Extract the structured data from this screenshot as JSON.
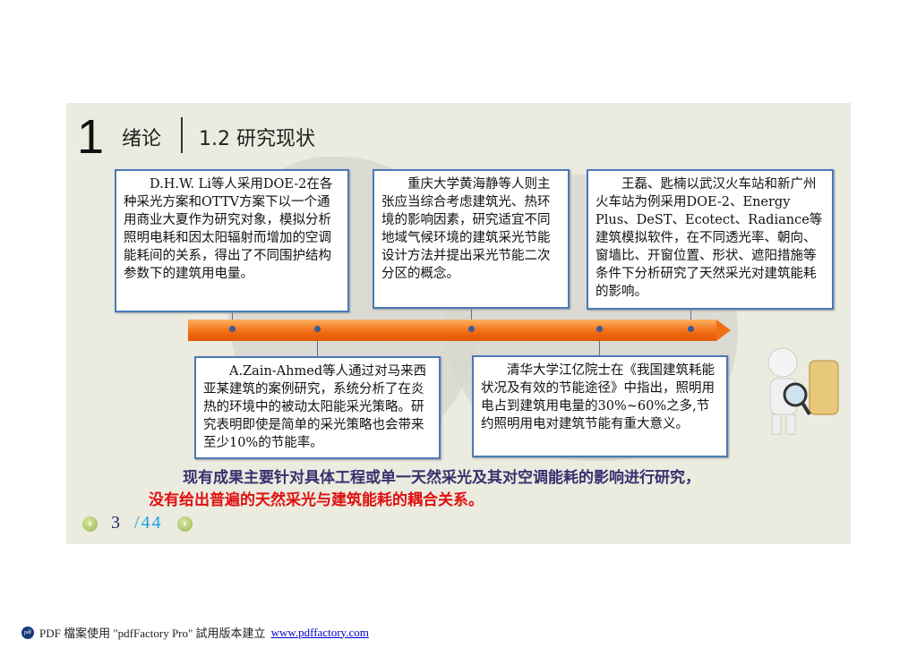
{
  "header": {
    "chapter_number": "1",
    "chapter_title": "绪论",
    "section_title": "1.2 研究现状"
  },
  "boxes": [
    "D.H.W. Li等人采用DOE-2在各种采光方案和OTTV方案下以一个通用商业大夏作为研究对象，模拟分析照明电耗和因太阳辐射而增加的空调能耗间的关系，得出了不同围护结构参数下的建筑用电量。",
    "重庆大学黄海静等人则主张应当综合考虑建筑光、热环境的影响因素，研究适宜不同地域气候环境的建筑采光节能设计方法并提出采光节能二次分区的概念。",
    "王磊、匙楠以武汉火车站和新广州火车站为例采用DOE-2、Energy Plus、DeST、Ecotect、Radiance等建筑模拟软件，在不同透光率、朝向、窗墙比、开窗位置、形状、遮阳措施等条件下分析研究了天然采光对建筑能耗的影响。",
    "A.Zain-Ahmed等人通过对马来西亚某建筑的案例研究，系统分析了在炎热的环境中的被动太阳能采光策略。研究表明即使是简单的采光策略也会带来至少10%的节能率。",
    "清华大学江亿院士在《我国建筑耗能状况及有效的节能途径》中指出，照明用电占到建筑用电量的30%~60%之多,节约照明用电对建筑节能有重大意义。"
  ],
  "conclusion": {
    "line1": "现有成果主要针对具体工程或单一天然采光及其对空调能耗的影响进行研究，",
    "line2": "没有给出普遍的天然采光与建筑能耗的耦合关系。",
    "line1_color": "#3b2f6e",
    "line2_color": "#e01010"
  },
  "pagination": {
    "current": "3",
    "total": "/44",
    "prev_icon": "chevron-left-icon",
    "next_icon": "chevron-right-icon"
  },
  "footer": {
    "text": "PDF 檔案使用 \"pdfFactory Pro\" 試用版本建立",
    "link": "www.pdffactory.com",
    "icon_label": "pdf"
  }
}
